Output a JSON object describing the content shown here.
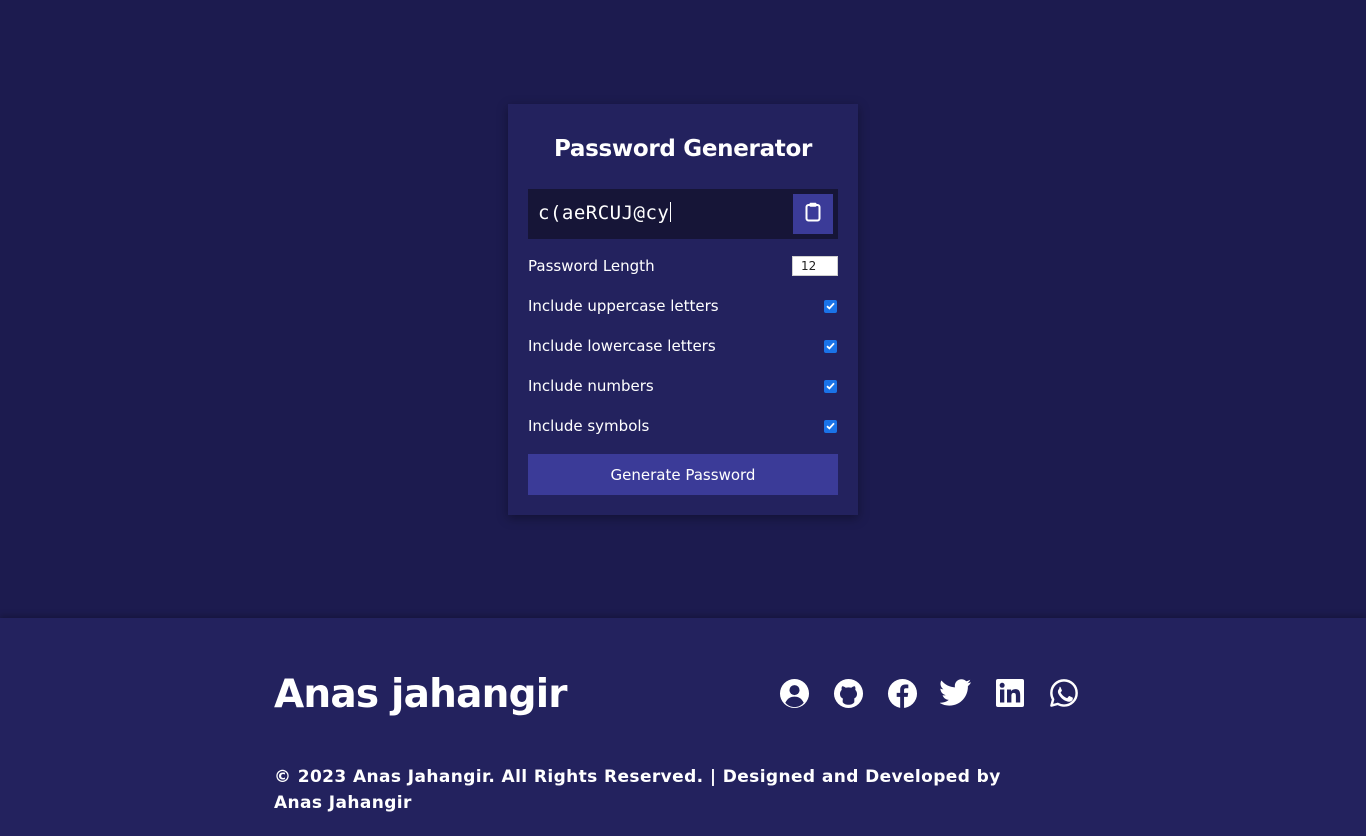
{
  "generator": {
    "title": "Password Generator",
    "result_value": "c(aeRCUJ@cy",
    "length_label": "Password Length",
    "length_value": "12",
    "options": [
      {
        "label": "Include uppercase letters",
        "checked": true
      },
      {
        "label": "Include lowercase letters",
        "checked": true
      },
      {
        "label": "Include numbers",
        "checked": true
      },
      {
        "label": "Include symbols",
        "checked": true
      }
    ],
    "generate_label": "Generate Password"
  },
  "footer": {
    "name": "Anas jahangir",
    "social_icons": [
      "user-circle-icon",
      "github-icon",
      "facebook-icon",
      "twitter-icon",
      "linkedin-icon",
      "whatsapp-icon"
    ],
    "copyright": "© 2023 Anas Jahangir. All Rights Reserved. | Designed and Developed by Anas Jahangir"
  },
  "colors": {
    "background": "#1c1b4f",
    "card": "#23225e",
    "result_box": "#161537",
    "accent": "#3b3b98",
    "checkbox": "#1a73e8"
  }
}
